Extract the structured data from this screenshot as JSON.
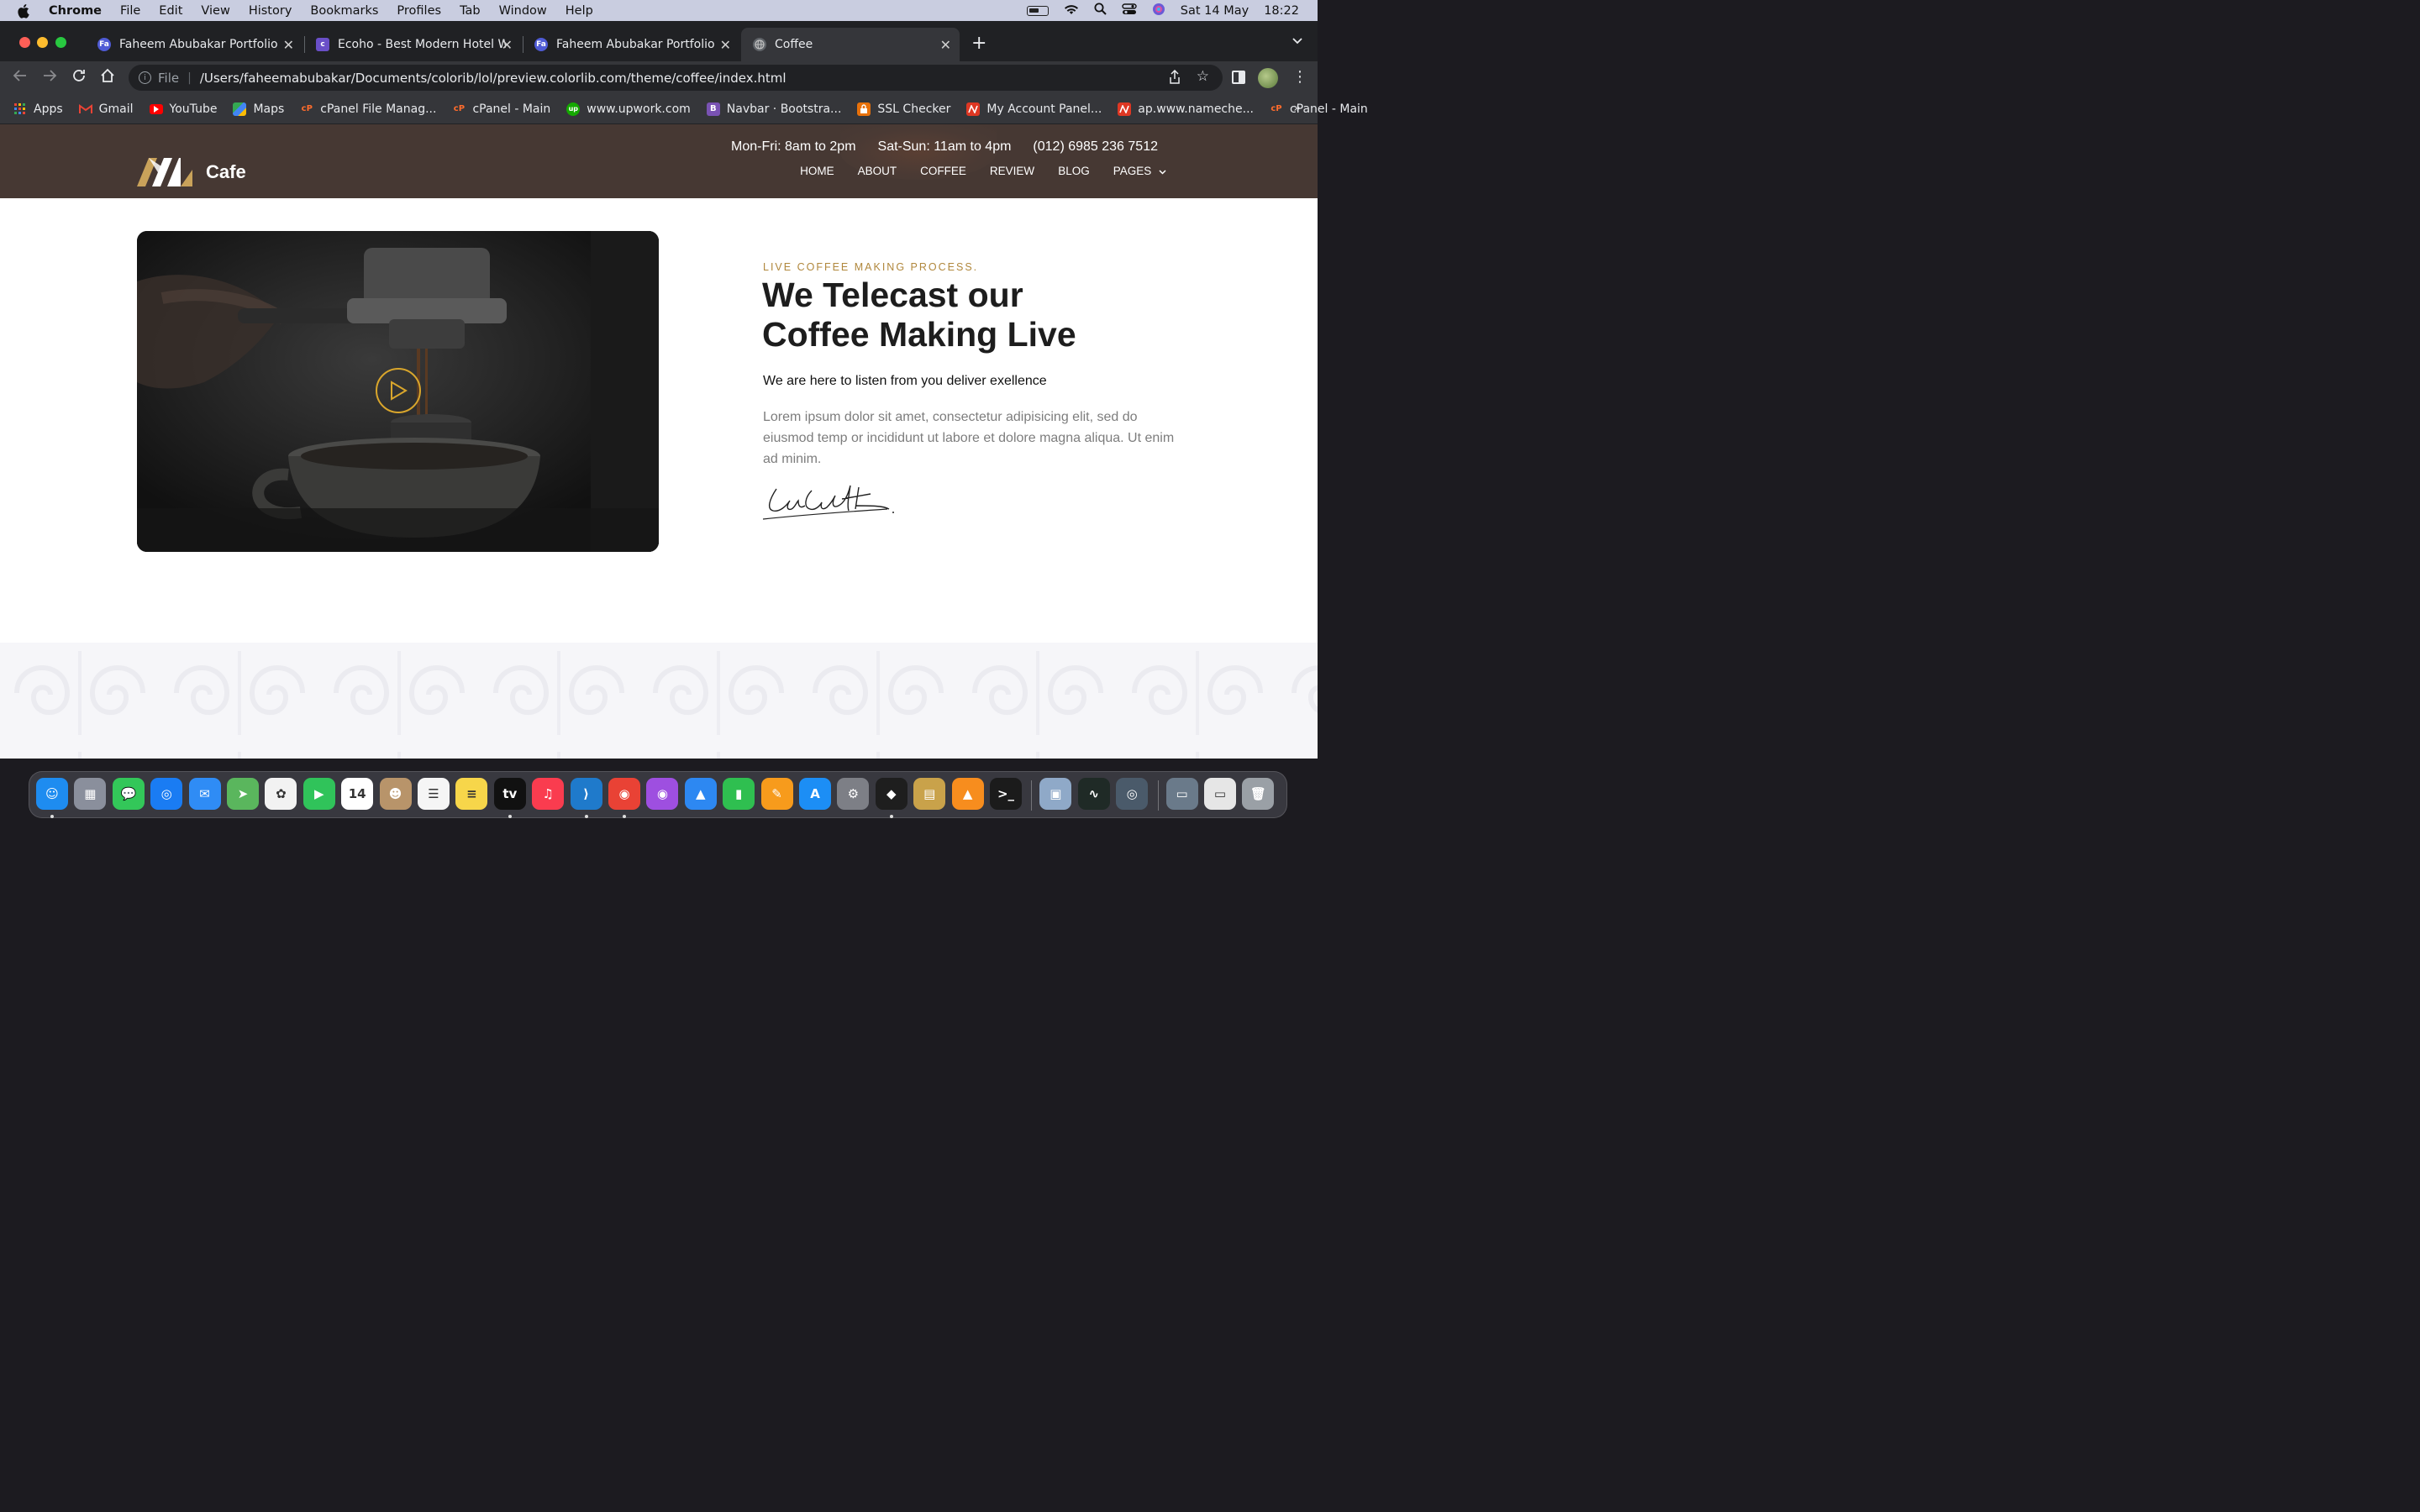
{
  "menubar": {
    "app": "Chrome",
    "items": [
      "File",
      "Edit",
      "View",
      "History",
      "Bookmarks",
      "Profiles",
      "Tab",
      "Window",
      "Help"
    ],
    "date": "Sat 14 May",
    "time": "18:22"
  },
  "tabs": [
    {
      "title": "Faheem Abubakar Portfolio",
      "favicon": "portfolio-icon",
      "color": "#4f5bd5"
    },
    {
      "title": "Ecoho - Best Modern Hotel We",
      "favicon": "colorlib-icon",
      "color": "#6a4fc8"
    },
    {
      "title": "Faheem Abubakar Portfolio",
      "favicon": "portfolio-icon",
      "color": "#4f5bd5"
    },
    {
      "title": "Coffee",
      "favicon": "globe-icon",
      "color": "#9aa0a6"
    }
  ],
  "omnibox": {
    "scheme": "File",
    "url": "/Users/faheemabubakar/Documents/colorib/lol/preview.colorlib.com/theme/coffee/index.html"
  },
  "bookmarks": [
    {
      "label": "Apps",
      "icon": "apps-grid-icon",
      "color": "#4285f4"
    },
    {
      "label": "Gmail",
      "icon": "gmail-icon",
      "color": "#ea4335"
    },
    {
      "label": "YouTube",
      "icon": "youtube-icon",
      "color": "#ff0000"
    },
    {
      "label": "Maps",
      "icon": "maps-icon",
      "color": "#34a853"
    },
    {
      "label": "cPanel File Manag...",
      "icon": "cpanel-icon",
      "color": "#ff6c2c"
    },
    {
      "label": "cPanel - Main",
      "icon": "cpanel-icon",
      "color": "#ff6c2c"
    },
    {
      "label": "www.upwork.com",
      "icon": "upwork-icon",
      "color": "#14a800"
    },
    {
      "label": "Navbar · Bootstra...",
      "icon": "bootstrap-icon",
      "color": "#7952b3"
    },
    {
      "label": "SSL Checker",
      "icon": "lock-icon",
      "color": "#e8710a"
    },
    {
      "label": "My Account Panel...",
      "icon": "namecheap-icon",
      "color": "#de3723"
    },
    {
      "label": "ap.www.nameche...",
      "icon": "namecheap-icon",
      "color": "#de3723"
    },
    {
      "label": "cPanel - Main",
      "icon": "cpanel-icon",
      "color": "#ff6c2c"
    }
  ],
  "site": {
    "brand": "Cafe",
    "hours": [
      "Mon-Fri: 8am to 2pm",
      "Sat-Sun: 11am to 4pm"
    ],
    "phone": "(012) 6985 236 7512",
    "nav": [
      "HOME",
      "ABOUT",
      "COFFEE",
      "REVIEW",
      "BLOG",
      "PAGES"
    ],
    "eyebrow": "LIVE COFFEE MAKING PROCESS.",
    "headline_line1": "We Telecast our",
    "headline_line2": "Coffee Making Live",
    "subhead": "We are here to listen from you deliver exellence",
    "body": "Lorem ipsum dolor sit amet, consectetur adipisicing elit, sed do eiusmod temp or incididunt ut labore et dolore magna aliqua. Ut enim ad minim.",
    "signature": "Lara Croft",
    "accent": "#b0873c",
    "header_bg": "#463833"
  },
  "dock": [
    {
      "name": "finder-icon",
      "color": "#1e8cf0",
      "glyph": "☺"
    },
    {
      "name": "launchpad-icon",
      "color": "#8a8f9c",
      "glyph": "▦"
    },
    {
      "name": "messages-icon",
      "color": "#33c759",
      "glyph": "💬"
    },
    {
      "name": "safari-icon",
      "color": "#1a7cf3",
      "glyph": "◎"
    },
    {
      "name": "mail-icon",
      "color": "#2f8cf5",
      "glyph": "✉"
    },
    {
      "name": "maps-icon",
      "color": "#5ab65d",
      "glyph": "➤"
    },
    {
      "name": "photos-icon",
      "color": "#f2f2f2",
      "glyph": "✿"
    },
    {
      "name": "facetime-icon",
      "color": "#30c35a",
      "glyph": "▶"
    },
    {
      "name": "calendar-icon",
      "color": "#ffffff",
      "glyph": "14"
    },
    {
      "name": "contacts-icon",
      "color": "#b8946a",
      "glyph": "☻"
    },
    {
      "name": "reminders-icon",
      "color": "#f5f5f5",
      "glyph": "☰"
    },
    {
      "name": "notes-icon",
      "color": "#f7d64a",
      "glyph": "≡"
    },
    {
      "name": "apple-tv-icon",
      "color": "#111111",
      "glyph": "tv"
    },
    {
      "name": "music-icon",
      "color": "#fa3c4f",
      "glyph": "♫"
    },
    {
      "name": "vscode-icon",
      "color": "#1f7acb",
      "glyph": "⟩"
    },
    {
      "name": "chrome-icon",
      "color": "#e94235",
      "glyph": "◉"
    },
    {
      "name": "podcasts-icon",
      "color": "#9e4fe0",
      "glyph": "◉"
    },
    {
      "name": "keynote-icon",
      "color": "#2d88f2",
      "glyph": "▲"
    },
    {
      "name": "numbers-icon",
      "color": "#2fbf50",
      "glyph": "▮"
    },
    {
      "name": "pages-icon",
      "color": "#f79b1c",
      "glyph": "✎"
    },
    {
      "name": "app-store-icon",
      "color": "#1c8ef5",
      "glyph": "A"
    },
    {
      "name": "system-preferences-icon",
      "color": "#7d7f86",
      "glyph": "⚙"
    },
    {
      "name": "figma-icon",
      "color": "#1e1e1e",
      "glyph": "◆"
    },
    {
      "name": "archive-utility-icon",
      "color": "#c9a24a",
      "glyph": "▤"
    },
    {
      "name": "vlc-icon",
      "color": "#f78d1e",
      "glyph": "▲"
    },
    {
      "name": "terminal-icon",
      "color": "#1b1b1b",
      "glyph": ">_"
    },
    {
      "name": "preview-icon",
      "color": "#8fa9c8",
      "glyph": "▣"
    },
    {
      "name": "activity-monitor-icon",
      "color": "#1f2a26",
      "glyph": "∿"
    },
    {
      "name": "quicktime-icon",
      "color": "#4a5a6a",
      "glyph": "◎"
    },
    {
      "name": "screenshot-thumb-icon",
      "color": "#6a7a8a",
      "glyph": "▭"
    },
    {
      "name": "document-thumb-icon",
      "color": "#e6e6e6",
      "glyph": "▭"
    },
    {
      "name": "trash-icon",
      "color": "#9aa0a6",
      "glyph": "🗑"
    }
  ]
}
